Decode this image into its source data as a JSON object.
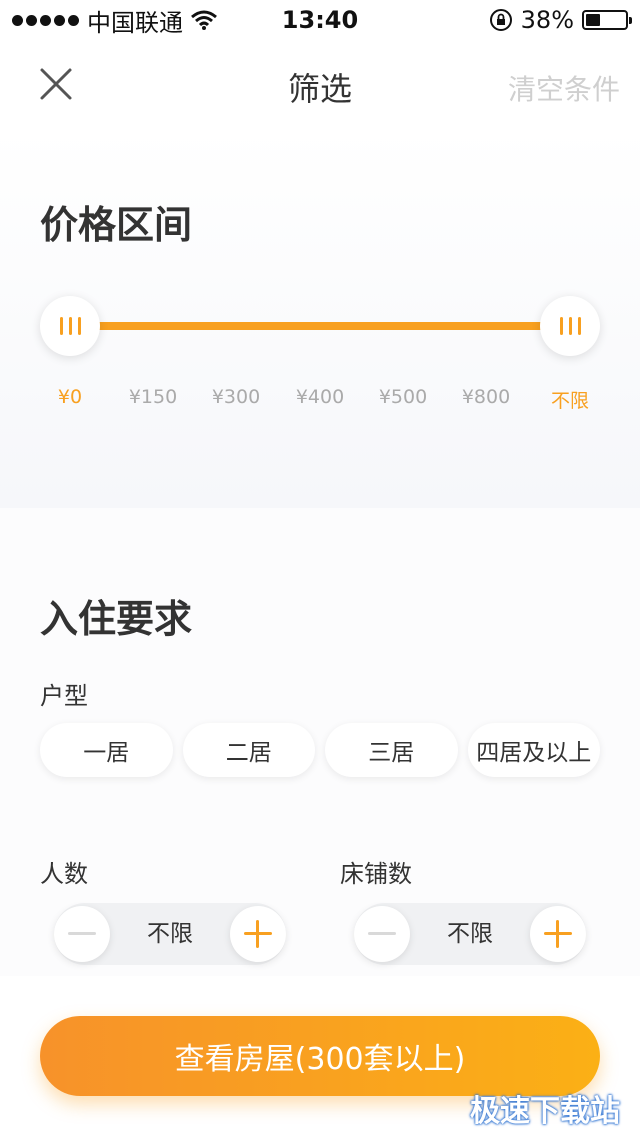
{
  "status": {
    "carrier": "中国联通",
    "time": "13:40",
    "battery": "38%",
    "battery_level": 0.38
  },
  "nav": {
    "title": "筛选",
    "clear": "清空条件"
  },
  "price": {
    "title": "价格区间",
    "labels": [
      "¥0",
      "¥150",
      "¥300",
      "¥400",
      "¥500",
      "¥800",
      "不限"
    ],
    "selected_min": "¥0",
    "selected_max": "不限"
  },
  "requirements": {
    "title": "入住要求",
    "room_type_label": "户型",
    "room_types": [
      "一居",
      "二居",
      "三居",
      "四居及以上"
    ],
    "people_label": "人数",
    "people_value": "不限",
    "beds_label": "床铺数",
    "beds_value": "不限"
  },
  "cta": {
    "label": "查看房屋(300套以上)"
  },
  "watermark": "极速下载站",
  "colors": {
    "accent": "#f8a020",
    "muted": "#aaaaaa"
  }
}
